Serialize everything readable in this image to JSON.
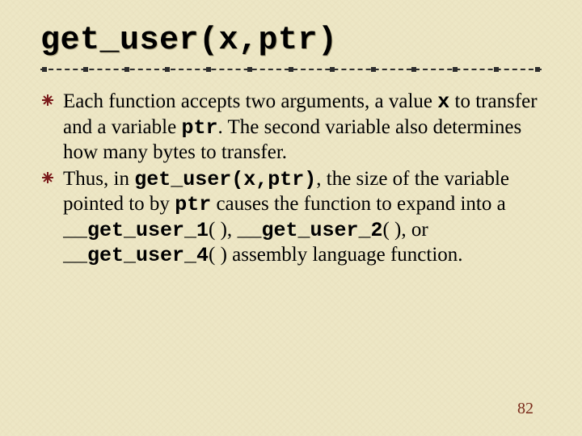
{
  "title": "get_user(x,ptr)",
  "bullets": [
    {
      "parts": [
        {
          "t": "Each function accepts two arguments, a value "
        },
        {
          "t": "x",
          "mono": true
        },
        {
          "t": " to transfer and a variable "
        },
        {
          "t": "ptr",
          "mono": true
        },
        {
          "t": ". The second variable also determines how many bytes to transfer."
        }
      ]
    },
    {
      "parts": [
        {
          "t": "Thus, in "
        },
        {
          "t": "get_user(x,ptr)",
          "mono": true
        },
        {
          "t": ", the size of the variable pointed to by "
        },
        {
          "t": "ptr",
          "mono": true
        },
        {
          "t": " causes the function to expand into a "
        },
        {
          "t": "__get_user_1",
          "mono": true
        },
        {
          "t": "( ), "
        },
        {
          "t": "__get_user_2",
          "mono": true
        },
        {
          "t": "( ), or "
        },
        {
          "t": "__get_user_4",
          "mono": true
        },
        {
          "t": "( ) assembly language function."
        }
      ]
    }
  ],
  "page_number": "82"
}
